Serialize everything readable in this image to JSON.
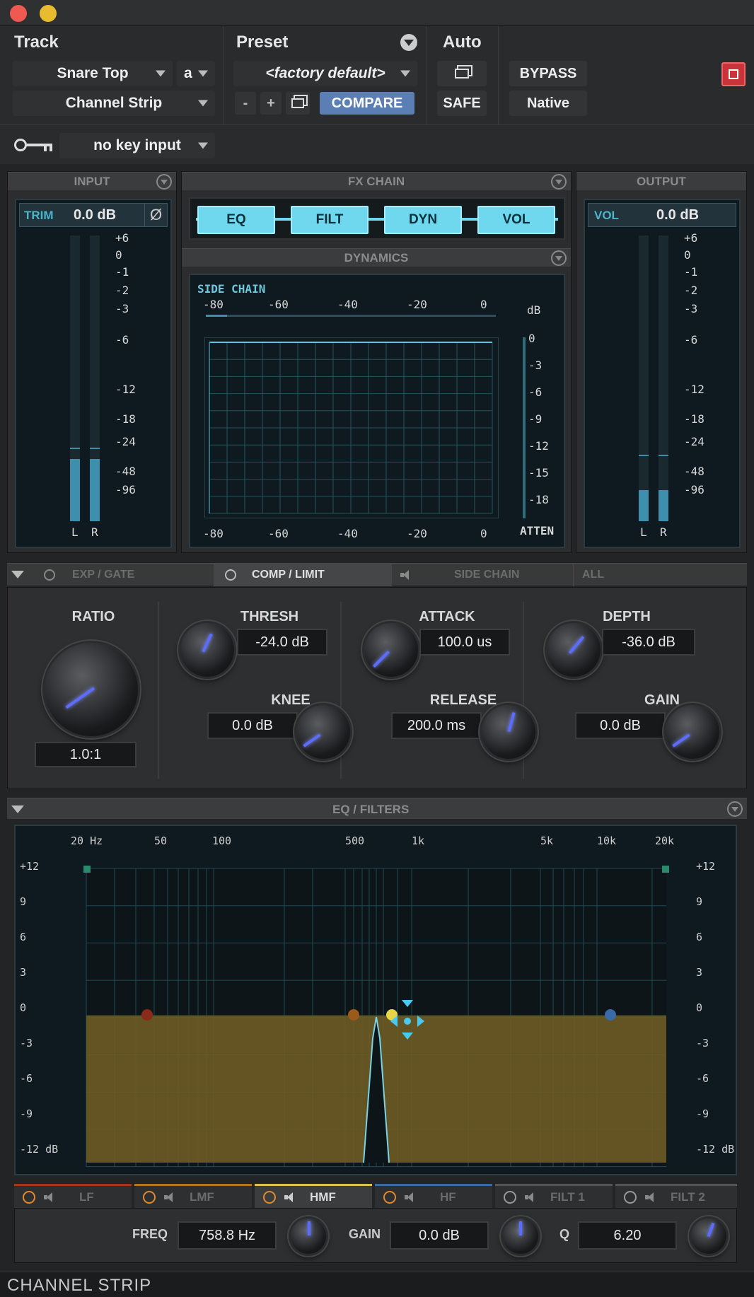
{
  "header": {
    "track_label": "Track",
    "preset_label": "Preset",
    "auto_label": "Auto"
  },
  "track": {
    "name": "Snare Top",
    "channel": "a",
    "plugin": "Channel Strip"
  },
  "preset": {
    "name": "<factory default>",
    "minus": "-",
    "plus": "+",
    "compare": "COMPARE"
  },
  "auto": {
    "safe": "SAFE"
  },
  "right": {
    "bypass": "BYPASS",
    "native": "Native"
  },
  "key": {
    "value": "no key input"
  },
  "input": {
    "title": "INPUT",
    "trim_label": "TRIM",
    "trim_value": "0.0 dB",
    "phase": "Ø",
    "ticks": [
      "+6",
      "0",
      "-1",
      "-2",
      "-3",
      "-6",
      "-12",
      "-18",
      "-24",
      "-48",
      "-96"
    ],
    "l": "L",
    "r": "R"
  },
  "output": {
    "title": "OUTPUT",
    "vol_label": "VOL",
    "vol_value": "0.0 dB",
    "ticks": [
      "+6",
      "0",
      "-1",
      "-2",
      "-3",
      "-6",
      "-12",
      "-18",
      "-24",
      "-48",
      "-96"
    ],
    "l": "L",
    "r": "R"
  },
  "fx": {
    "title": "FX CHAIN",
    "buttons": [
      "EQ",
      "FILT",
      "DYN",
      "VOL"
    ]
  },
  "dynamics": {
    "title": "DYNAMICS",
    "side_chain": "SIDE CHAIN",
    "top_ticks": [
      "-80",
      "-60",
      "-40",
      "-20",
      "0"
    ],
    "db": "dB",
    "right_ticks": [
      "0",
      "-3",
      "-6",
      "-9",
      "-12",
      "-15",
      "-18"
    ],
    "atten": "ATTEN",
    "bottom_ticks": [
      "-80",
      "-60",
      "-40",
      "-20",
      "0"
    ]
  },
  "tabs": {
    "exp": "EXP / GATE",
    "comp": "COMP / LIMIT",
    "side": "SIDE CHAIN",
    "all": "ALL"
  },
  "comp": {
    "ratio_label": "RATIO",
    "ratio": "1.0:1",
    "thresh_label": "THRESH",
    "thresh": "-24.0 dB",
    "knee_label": "KNEE",
    "knee": "0.0 dB",
    "attack_label": "ATTACK",
    "attack": "100.0 us",
    "release_label": "RELEASE",
    "release": "200.0 ms",
    "depth_label": "DEPTH",
    "depth": "-36.0 dB",
    "gain_label": "GAIN",
    "gain": "0.0 dB"
  },
  "eq": {
    "title": "EQ / FILTERS",
    "freq_ticks": [
      "20 Hz",
      "50",
      "100",
      "500",
      "1k",
      "5k",
      "10k",
      "20k"
    ],
    "db_ticks_left": [
      "+12",
      "9",
      "6",
      "3",
      "0",
      "-3",
      "-6",
      "-9",
      "-12 dB"
    ],
    "db_ticks_right": [
      "+12",
      "9",
      "6",
      "3",
      "0",
      "-3",
      "-6",
      "-9",
      "-12 dB"
    ],
    "bands": [
      "LF",
      "LMF",
      "HMF",
      "HF",
      "FILT 1",
      "FILT 2"
    ],
    "freq_label": "FREQ",
    "freq": "758.8 Hz",
    "gain_label": "GAIN",
    "gain": "0.0 dB",
    "q_label": "Q",
    "q": "6.20"
  },
  "footer": {
    "title": "CHANNEL STRIP"
  },
  "colors": {
    "accent": "#6fd8ee",
    "eq_fill": "#6b5a24",
    "power_on": "#e48a2a"
  }
}
